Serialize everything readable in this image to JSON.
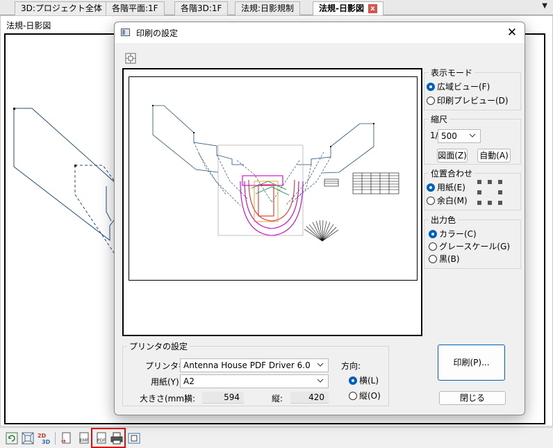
{
  "tabs": [
    {
      "label": "3D:プロジェクト全体",
      "active": false
    },
    {
      "label": "各階平面:1F",
      "active": false
    },
    {
      "label": "各階3D:1F",
      "active": false
    },
    {
      "label": "法規:日影規制",
      "active": false
    },
    {
      "label": "法規-日影図",
      "active": true,
      "closable": true
    }
  ],
  "tab_close_glyph": "x",
  "tab_menu_glyph": "▼",
  "document": {
    "title": "法規-日影図"
  },
  "dialog": {
    "title": "印刷の設定",
    "close_glyph": "✕",
    "display_mode": {
      "label": "表示モード",
      "options": [
        {
          "label": "広域ビュー(F)",
          "selected": true
        },
        {
          "label": "印刷プレビュー(D)",
          "selected": false
        }
      ]
    },
    "scale": {
      "label": "縮尺",
      "prefix": "1/",
      "value": "500",
      "drawing_button": "図面(Z)",
      "auto_button": "自動(A)"
    },
    "alignment": {
      "label": "位置合わせ",
      "options": [
        {
          "label": "用紙(E)",
          "selected": true
        },
        {
          "label": "余白(M)",
          "selected": false
        }
      ]
    },
    "output_color": {
      "label": "出力色",
      "options": [
        {
          "label": "カラー(C)",
          "selected": true
        },
        {
          "label": "グレースケール(G)",
          "selected": false
        },
        {
          "label": "黒(B)",
          "selected": false
        }
      ]
    },
    "printer_settings": {
      "label": "プリンタの設定",
      "printer_name_label": "プリンタ名",
      "printer_name_value": "Antenna House PDF Driver 6.0",
      "paper_label": "用紙(Y)",
      "paper_value": "A2",
      "size_label": "大きさ(mm)",
      "width_label": "横:",
      "width_value": "594",
      "height_label": "縦:",
      "height_value": "420",
      "orientation_label": "方向:",
      "orientation_options": [
        {
          "label": "横(L)",
          "selected": true
        },
        {
          "label": "縦(O)",
          "selected": false
        }
      ]
    },
    "print_button": "印刷(P)...",
    "close_button": "閉じる"
  },
  "bottom_toolbar": {
    "icons": [
      "refresh-icon",
      "fit-view-icon",
      "2d-3d-toggle-icon",
      "export-icon",
      "export-emf-icon",
      "export-pdf-icon",
      "print-icon",
      "print-preview-icon"
    ],
    "highlighted": [
      "export-pdf-icon",
      "print-icon"
    ]
  },
  "colors": {
    "accent": "#005fb8",
    "highlight": "#e01010",
    "drawing_line": "#1f4e79",
    "drawing_magenta": "#cc00cc",
    "drawing_red": "#e03030"
  }
}
